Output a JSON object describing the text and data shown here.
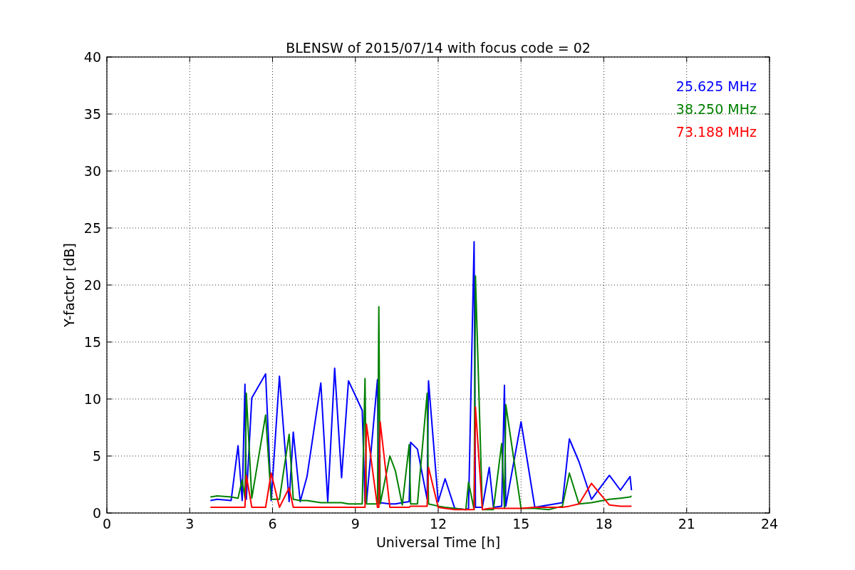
{
  "chart_data": {
    "type": "line",
    "title": "BLENSW of 2015/07/14 with focus code = 02",
    "xlabel": "Universal Time [h]",
    "ylabel": "Y-factor [dB]",
    "x": [
      3.75,
      4.0,
      4.5,
      4.75,
      4.9,
      5.0,
      5.05,
      5.25,
      5.75,
      5.95,
      6.25,
      6.6,
      6.75,
      7.0,
      7.25,
      7.75,
      8.0,
      8.25,
      8.5,
      8.75,
      9.25,
      9.35,
      9.4,
      9.8,
      9.85,
      9.9,
      10.25,
      10.45,
      10.7,
      10.95,
      11.0,
      11.25,
      11.6,
      11.65,
      12.0,
      12.25,
      12.6,
      13.0,
      13.1,
      13.3,
      13.35,
      13.6,
      13.85,
      14.0,
      14.3,
      14.4,
      14.45,
      15.0,
      15.5,
      16.0,
      16.5,
      16.75,
      17.1,
      17.55,
      18.2,
      18.6,
      18.95,
      19.0
    ],
    "series": [
      {
        "name": "25.625 MHz",
        "color": "#0000ff",
        "values": [
          1.1,
          1.2,
          1.1,
          5.9,
          1.1,
          11.3,
          1.2,
          10.1,
          12.2,
          1.1,
          12.0,
          1.0,
          7.1,
          1.0,
          3.2,
          11.4,
          1.0,
          12.7,
          3.1,
          11.6,
          9.0,
          1.0,
          0.9,
          11.7,
          0.9,
          0.9,
          0.8,
          0.8,
          0.9,
          1.0,
          6.2,
          5.6,
          1.2,
          11.6,
          1.0,
          3.0,
          0.4,
          0.3,
          0.4,
          23.8,
          0.5,
          0.5,
          4.0,
          0.5,
          0.6,
          11.2,
          0.6,
          8.0,
          0.5,
          0.7,
          0.9,
          6.5,
          4.5,
          1.2,
          3.3,
          2.0,
          3.2,
          2.0
        ]
      },
      {
        "name": "38.250 MHz",
        "color": "#008000",
        "values": [
          1.4,
          1.5,
          1.4,
          1.3,
          2.9,
          1.3,
          10.5,
          1.3,
          8.6,
          1.2,
          1.2,
          6.9,
          1.2,
          1.1,
          1.1,
          0.9,
          0.9,
          0.9,
          0.9,
          0.8,
          0.8,
          11.8,
          0.8,
          0.8,
          18.1,
          0.8,
          5.0,
          3.7,
          0.7,
          6.0,
          0.8,
          0.8,
          10.5,
          0.8,
          0.6,
          0.5,
          0.4,
          0.3,
          2.7,
          0.3,
          20.8,
          0.3,
          0.3,
          0.3,
          6.1,
          0.4,
          9.5,
          0.4,
          0.4,
          0.3,
          0.6,
          3.5,
          0.8,
          0.9,
          1.2,
          1.3,
          1.4,
          1.5
        ]
      },
      {
        "name": "73.188 MHz",
        "color": "#ff0000",
        "values": [
          0.5,
          0.5,
          0.5,
          0.5,
          0.5,
          0.5,
          3.3,
          0.5,
          0.5,
          3.5,
          0.5,
          2.2,
          0.5,
          0.5,
          0.5,
          0.5,
          0.5,
          0.5,
          0.5,
          0.5,
          0.5,
          0.5,
          7.8,
          0.5,
          0.5,
          8.0,
          0.5,
          0.5,
          0.5,
          0.5,
          0.6,
          0.6,
          0.6,
          4.0,
          0.5,
          0.4,
          0.3,
          0.3,
          0.3,
          0.3,
          9.3,
          0.3,
          0.4,
          0.4,
          0.4,
          0.4,
          0.4,
          0.4,
          0.5,
          0.5,
          0.5,
          0.6,
          0.8,
          2.6,
          0.7,
          0.6,
          0.6,
          0.6
        ]
      }
    ],
    "xlim": [
      0,
      24
    ],
    "ylim": [
      0,
      40
    ],
    "xticks": [
      0,
      3,
      6,
      9,
      12,
      15,
      18,
      21,
      24
    ],
    "yticks": [
      0,
      5,
      10,
      15,
      20,
      25,
      30,
      35,
      40
    ],
    "grid": true
  }
}
